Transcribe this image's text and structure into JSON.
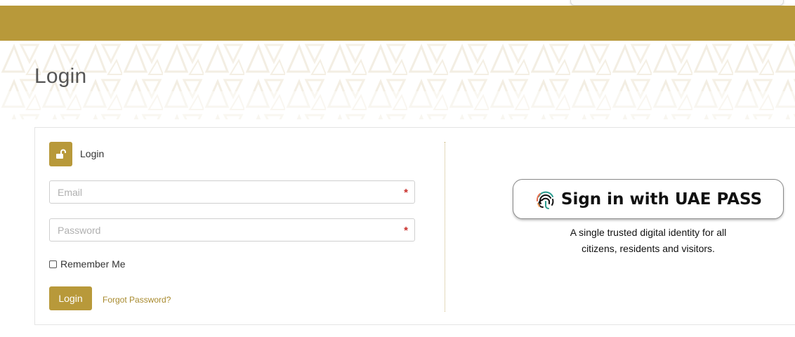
{
  "page": {
    "title": "Login"
  },
  "login_panel": {
    "heading": "Login",
    "lock_icon": "unlock-icon",
    "email": {
      "placeholder": "Email",
      "value": "",
      "required_marker": "*"
    },
    "password": {
      "placeholder": "Password",
      "value": "",
      "required_marker": "*"
    },
    "remember_me": {
      "label": "Remember Me",
      "checked": false
    },
    "login_button": "Login",
    "forgot_password": "Forgot Password?"
  },
  "uae_pass": {
    "button_label": "Sign in with UAE PASS",
    "icon": "fingerprint-icon",
    "description_line1": "A single trusted digital identity for all",
    "description_line2": "citizens, residents and visitors."
  },
  "colors": {
    "brand_gold": "#b8993a",
    "link_gold": "#a88a2e",
    "required_red": "#c9302c"
  }
}
